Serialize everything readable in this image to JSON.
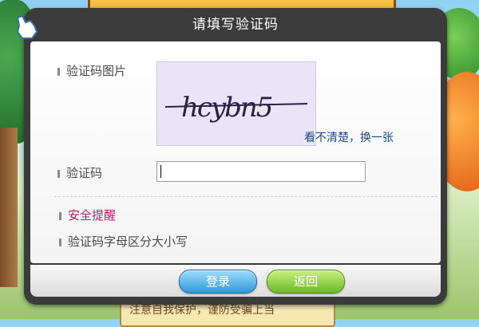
{
  "dialog": {
    "title": "请填写验证码",
    "captcha_label": "验证码图片",
    "captcha_text": "hcybn5",
    "refresh_link": "看不清楚，换一张",
    "code_label": "验证码",
    "code_value": "",
    "tip_title": "安全提醒",
    "tip_text": "验证码字母区分大小写",
    "login_button": "登录",
    "back_button": "返回"
  },
  "background": {
    "bottom_sign_text": "注意自我保护，谨防受骗上当"
  },
  "colors": {
    "dialog_frame": "#3b3b3b",
    "tip_title": "#b2246b",
    "link": "#1a4b86",
    "login_button": "#2f9ad8",
    "back_button": "#6ab92a"
  },
  "icons": [
    "glove-cursor-icon",
    "bullet-icon"
  ]
}
